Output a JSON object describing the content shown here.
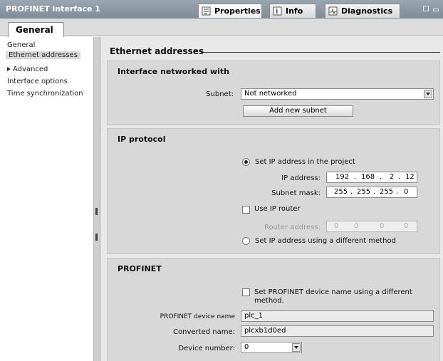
{
  "window": {
    "title": "PROFINET interface 1",
    "tabs": [
      {
        "label": "Properties",
        "icon": "properties-icon"
      },
      {
        "label": "Info",
        "icon": "info-icon"
      },
      {
        "label": "Diagnostics",
        "icon": "diagnostics-icon"
      }
    ],
    "general_tab": "General"
  },
  "nav": {
    "items": [
      {
        "label": "General"
      },
      {
        "label": "Ethernet addresses",
        "selected": true
      },
      {
        "label": "Advanced",
        "expandable": true
      },
      {
        "label": "Interface options"
      },
      {
        "label": "Time synchronization"
      }
    ]
  },
  "main": {
    "section_title": "Ethernet addresses",
    "interface": {
      "title": "Interface networked with",
      "subnet_label": "Subnet:",
      "subnet_value": "Not networked",
      "add_subnet_label": "Add new subnet"
    },
    "ip": {
      "title": "IP protocol",
      "set_in_project_label": "Set IP address in the project",
      "ip_address_label": "IP address:",
      "ip_address": [
        "192",
        "168",
        "2",
        "12"
      ],
      "subnet_mask_label": "Subnet mask:",
      "subnet_mask": [
        "255",
        "255",
        "255",
        "0"
      ],
      "use_router_label": "Use IP router",
      "router_address_label": "Router address:",
      "router_address": [
        "0",
        "0",
        "0",
        "0"
      ],
      "different_method_label": "Set IP address using a different method"
    },
    "profinet": {
      "title": "PROFINET",
      "set_name_label_1": "Set PROFINET device name using a different",
      "set_name_label_2": "method.",
      "device_name_label": "PROFINET device name",
      "device_name": "plc_1",
      "converted_name_label": "Converted name:",
      "converted_name": "plcxb1d0ed",
      "device_number_label": "Device number:",
      "device_number": "0"
    }
  }
}
